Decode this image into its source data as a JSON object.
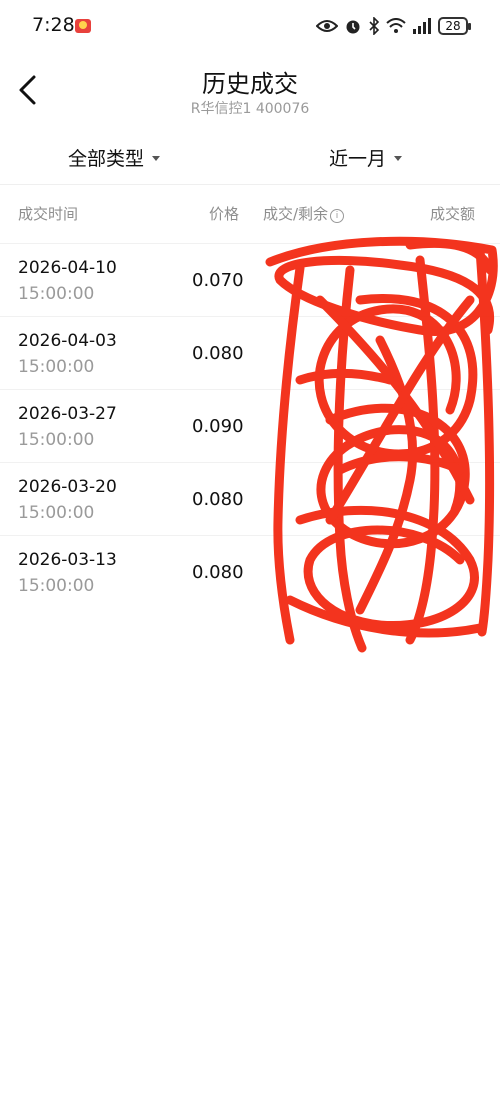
{
  "status_bar": {
    "time": "7:28",
    "battery": "28"
  },
  "header": {
    "title": "历史成交",
    "subtitle": "R华信控1 400076"
  },
  "filters": {
    "type_label": "全部类型",
    "period_label": "近一月"
  },
  "columns": {
    "time": "成交时间",
    "price": "价格",
    "deal_remain": "成交/剩余",
    "amount": "成交额",
    "info_glyph": "i"
  },
  "rows": [
    {
      "date": "2026-04-10",
      "time": "15:00:00",
      "price": "0.070"
    },
    {
      "date": "2026-04-03",
      "time": "15:00:00",
      "price": "0.080"
    },
    {
      "date": "2026-03-27",
      "time": "15:00:00",
      "price": "0.090"
    },
    {
      "date": "2026-03-20",
      "time": "15:00:00",
      "price": "0.080"
    },
    {
      "date": "2026-03-13",
      "time": "15:00:00",
      "price": "0.080"
    }
  ],
  "colors": {
    "scribble": "#f32a12",
    "muted_text": "#9a9a9a"
  }
}
